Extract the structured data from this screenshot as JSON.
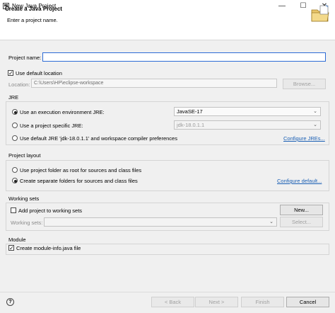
{
  "window": {
    "title": "New Java Project",
    "minimize_glyph": "—",
    "maximize_glyph": "☐",
    "close_glyph": "✕"
  },
  "banner": {
    "title": "Create a Java Project",
    "subtitle": "Enter a project name.",
    "icon": "new-folder-icon"
  },
  "project": {
    "name_label": "Project name:",
    "name_value": "",
    "use_default_location_label": "Use default location",
    "use_default_location_checked": true,
    "location_label": "Location:",
    "location_value": "C:\\Users\\HP\\eclipse-workspace",
    "browse_label": "Browse..."
  },
  "jre": {
    "group_title": "JRE",
    "option_env_label": "Use an execution environment JRE:",
    "option_env_value": "JavaSE-17",
    "option_specific_label": "Use a project specific JRE:",
    "option_specific_value": "jdk-18.0.1.1",
    "option_default_label": "Use default JRE 'jdk-18.0.1.1' and workspace compiler preferences",
    "configure_link": "Configure JREs...",
    "selected": "env"
  },
  "layout": {
    "group_title": "Project layout",
    "option_root_label": "Use project folder as root for sources and class files",
    "option_separate_label": "Create separate folders for sources and class files",
    "configure_link": "Configure default...",
    "selected": "separate"
  },
  "working_sets": {
    "group_title": "Working sets",
    "add_label": "Add project to working sets",
    "add_checked": false,
    "new_label": "New...",
    "sets_label": "Working sets:",
    "sets_value": "",
    "select_label": "Select..."
  },
  "module": {
    "group_title": "Module",
    "create_label": "Create module-info.java file",
    "create_checked": true
  },
  "footer": {
    "help_glyph": "?",
    "back_label": "< Back",
    "next_label": "Next >",
    "finish_label": "Finish",
    "cancel_label": "Cancel"
  }
}
